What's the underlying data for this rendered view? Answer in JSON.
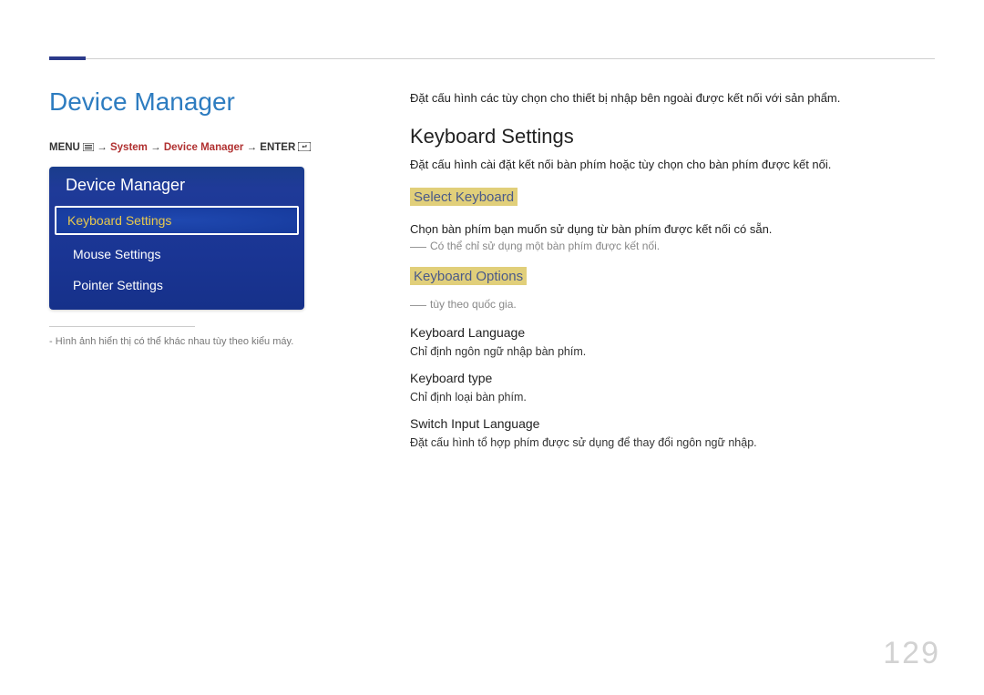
{
  "section_title": "Device Manager",
  "breadcrumb": {
    "menu": "MENU",
    "system": "System",
    "device_manager": "Device Manager",
    "enter": "ENTER",
    "arrow": " → "
  },
  "panel": {
    "title": "Device Manager",
    "items": [
      {
        "label": "Keyboard Settings",
        "selected": true
      },
      {
        "label": "Mouse Settings",
        "selected": false
      },
      {
        "label": "Pointer Settings",
        "selected": false
      }
    ],
    "note_prefix": "-",
    "note": "Hình ảnh hiển thị có thể khác nhau tùy theo kiểu máy."
  },
  "content": {
    "intro": "Đặt cấu hình các tùy chọn cho thiết bị nhập bên ngoài được kết nối với sản phẩm.",
    "h2": "Keyboard Settings",
    "h2_desc": "Đặt cấu hình cài đặt kết nối bàn phím hoặc tùy chọn cho bàn phím được kết nối.",
    "sections": [
      {
        "h3": "Select Keyboard",
        "desc": "Chọn bàn phím bạn muốn sử dụng từ bàn phím được kết nối có sẵn.",
        "note": "Có thể chỉ sử dụng một bàn phím được kết nối."
      },
      {
        "h3": "Keyboard Options",
        "note": "tùy theo quốc gia.",
        "subs": [
          {
            "h4": "Keyboard Language",
            "desc": "Chỉ định ngôn ngữ nhập bàn phím."
          },
          {
            "h4": "Keyboard type",
            "desc": "Chỉ định loại bàn phím."
          },
          {
            "h4": "Switch Input Language",
            "desc": "Đặt cấu hình tổ hợp phím được sử dụng để thay đổi ngôn ngữ nhập."
          }
        ]
      }
    ]
  },
  "page_number": "129"
}
